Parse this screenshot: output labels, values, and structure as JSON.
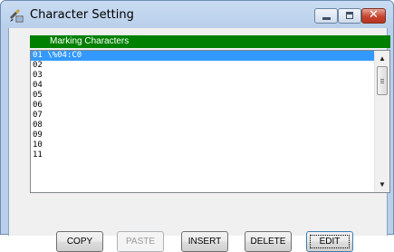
{
  "window": {
    "title": "Character Setting",
    "close_glyph": "✕"
  },
  "group": {
    "header": "Marking Characters"
  },
  "list": {
    "items": [
      "01 \\%04:C0",
      "02",
      "03",
      "04",
      "05",
      "06",
      "07",
      "08",
      "09",
      "10",
      "11"
    ],
    "selected_index": 0
  },
  "buttons": {
    "copy": "COPY",
    "paste": "PASTE",
    "insert": "INSERT",
    "delete": "DELETE",
    "edit": "EDIT"
  },
  "colors": {
    "header_bg": "#008000",
    "selection_bg": "#3399ff"
  }
}
